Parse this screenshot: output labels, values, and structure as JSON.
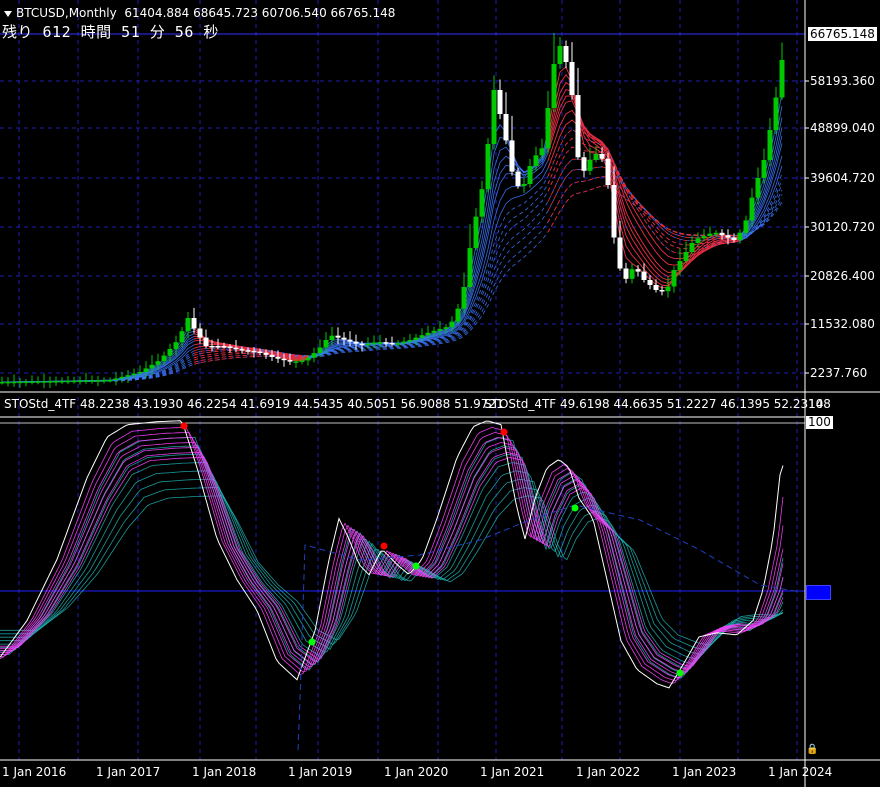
{
  "header": {
    "symbol": "BTCUSD,Monthly",
    "ohlc": "61404.884 68645.723 60706.540 66765.148",
    "countdown": "残り 612 時間 51 分 56 秒"
  },
  "price_axis": {
    "current_price": "66765.148",
    "labels": [
      "58193.360",
      "48899.040",
      "39604.720",
      "30120.720",
      "20826.400",
      "11532.080",
      "2237.760"
    ]
  },
  "indicator": {
    "legend_1": "STOStd_4TF 48.2238 43.1930 46.2254 41.6919 44.5435 40.5051 56.9088 51.9721",
    "legend_2": "STOStd_4TF 49.6198 44.6635 51.2227 46.1395 52.2314",
    "axis_top": "108",
    "level_high": "100",
    "level_mid": "50"
  },
  "time_axis": {
    "labels": [
      "1 Jan 2016",
      "1 Jan 2017",
      "1 Jan 2018",
      "1 Jan 2019",
      "1 Jan 2020",
      "1 Jan 2021",
      "1 Jan 2022",
      "1 Jan 2023",
      "1 Jan 2024"
    ]
  },
  "colors": {
    "background": "#000000",
    "grid": "#1e1eb4",
    "bull": "#00c800",
    "bear": "#ffffff",
    "ribbon_up": "#3c78ff",
    "ribbon_down": "#ff2020",
    "sto_fast": "#ff40ff",
    "sto_slow": "#20b4b4",
    "signal_up": "#00ff00",
    "signal_down": "#ff0000"
  }
}
